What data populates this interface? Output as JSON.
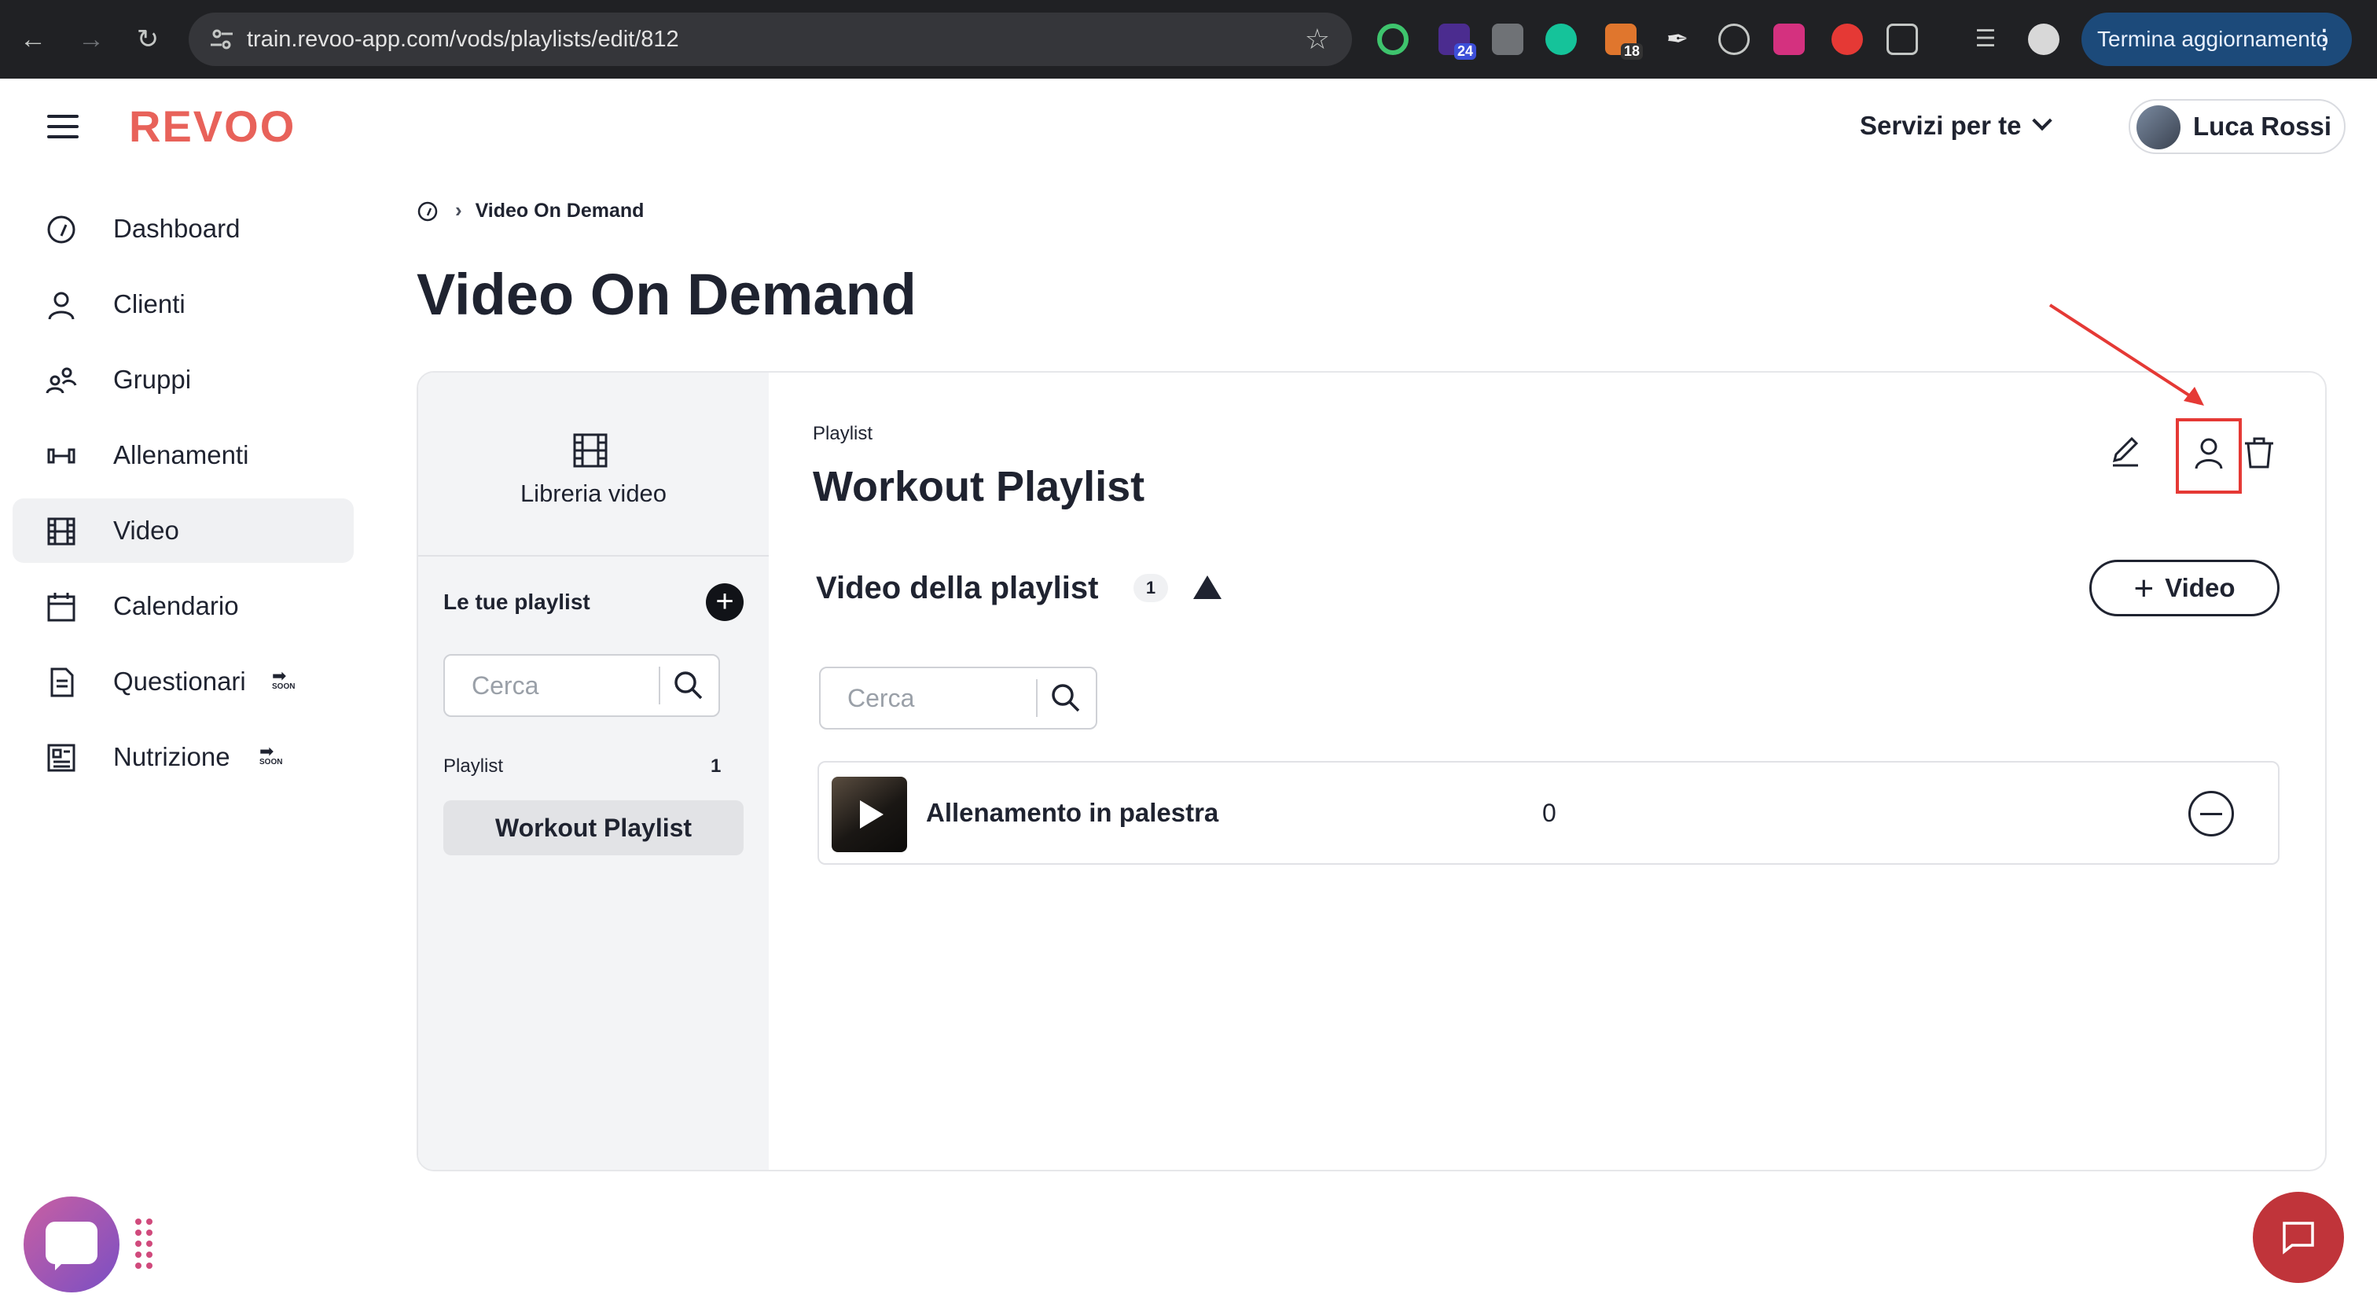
{
  "browser": {
    "url": "train.revoo-app.com/vods/playlists/edit/812",
    "update_label": "Termina aggiornamento",
    "ext_badges": {
      "ext2": "24",
      "ext5": "18"
    }
  },
  "header": {
    "logo": "REVOO",
    "services_label": "Servizi per te",
    "user_name": "Luca Rossi"
  },
  "sidebar": {
    "items": [
      {
        "label": "Dashboard"
      },
      {
        "label": "Clienti"
      },
      {
        "label": "Gruppi"
      },
      {
        "label": "Allenamenti"
      },
      {
        "label": "Video",
        "active": true
      },
      {
        "label": "Calendario"
      },
      {
        "label": "Questionari",
        "soon": "SOON"
      },
      {
        "label": "Nutrizione",
        "soon": "SOON"
      }
    ]
  },
  "breadcrumb": {
    "current": "Video On Demand"
  },
  "page_title": "Video On Demand",
  "library": {
    "label": "Libreria video",
    "playlists_header": "Le tue playlist",
    "search_placeholder": "Cerca",
    "list_header": "Playlist",
    "list_count": "1",
    "playlists": [
      "Workout Playlist"
    ]
  },
  "playlist": {
    "kicker": "Playlist",
    "title": "Workout Playlist",
    "section_title": "Video della playlist",
    "section_count": "1",
    "add_video_label": "Video",
    "search_placeholder": "Cerca",
    "videos": [
      {
        "name": "Allenamento in palestra",
        "count": "0"
      }
    ]
  },
  "colors": {
    "brand": "#e8625a",
    "highlight": "#e53935",
    "chat_fab": "#c0343a"
  }
}
